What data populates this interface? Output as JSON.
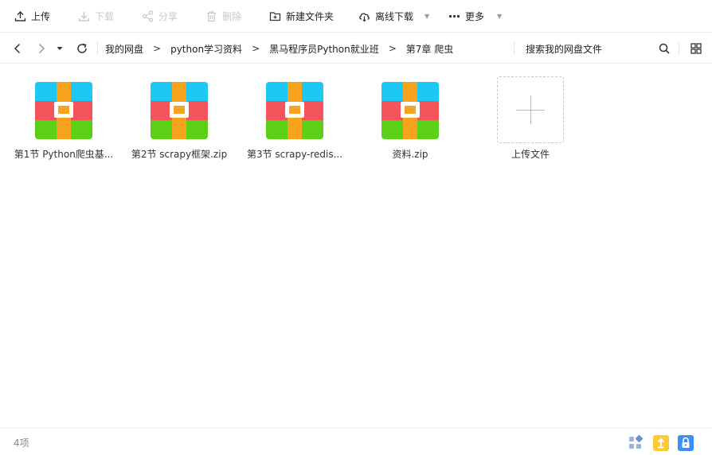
{
  "toolbar": {
    "upload": "上传",
    "download": "下载",
    "share": "分享",
    "delete": "删除",
    "new_folder": "新建文件夹",
    "offline_download": "离线下载",
    "more": "更多"
  },
  "navbar": {
    "breadcrumbs": [
      "我的网盘",
      "python学习资料",
      "黑马程序员Python就业班",
      "第7章 爬虫"
    ],
    "separator": ">",
    "search_placeholder": "搜索我的网盘文件"
  },
  "files": [
    {
      "name": "第1节 Python爬虫基...",
      "icon": "zip-file-icon"
    },
    {
      "name": "第2节 scrapy框架.zip",
      "icon": "zip-file-icon"
    },
    {
      "name": "第3节 scrapy-redis...",
      "icon": "zip-file-icon"
    },
    {
      "name": "资料.zip",
      "icon": "zip-file-icon"
    }
  ],
  "upload_tile": {
    "label": "上传文件"
  },
  "status": {
    "count": "4项"
  },
  "colors": {
    "zip_blue": "#1ec8f5",
    "zip_red": "#f5555a",
    "zip_green": "#5cd016",
    "zip_strap": "#f7a31d",
    "accent_blue": "#3d8ef7",
    "accent_yellow": "#ffc933"
  }
}
